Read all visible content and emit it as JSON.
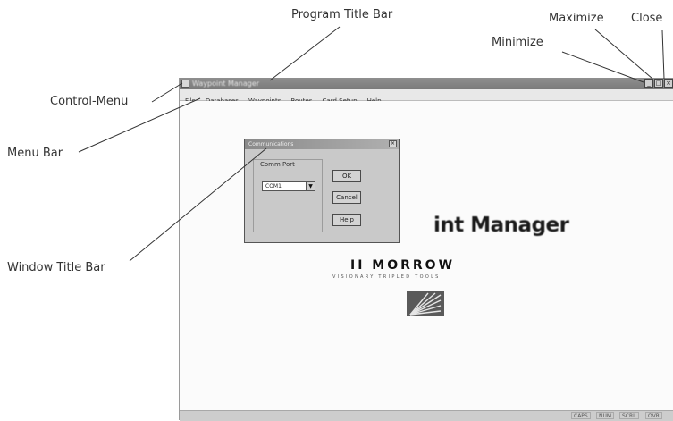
{
  "callouts": {
    "program_title_bar": "Program Title Bar",
    "maximize": "Maximize",
    "close": "Close",
    "minimize": "Minimize",
    "control_menu": "Control-Menu",
    "menu_bar": "Menu Bar",
    "window_title_bar": "Window Title Bar"
  },
  "app": {
    "title": "Waypoint Manager",
    "menu": [
      "File",
      "Databases",
      "Waypoints",
      "Routes",
      "Card Setup",
      "Help"
    ],
    "status": [
      "CAPS",
      "NUM",
      "SCRL",
      "OVR"
    ]
  },
  "splash": {
    "title": "int Manager",
    "brand": "II MORROW",
    "tagline": "VISIONARY TRIPLED TOOLS"
  },
  "dialog": {
    "title": "Communications",
    "close_glyph": "×",
    "group_label": "Comm Port",
    "port_value": "COM1",
    "ok_label": "OK",
    "cancel_label": "Cancel",
    "help_label": "Help"
  }
}
